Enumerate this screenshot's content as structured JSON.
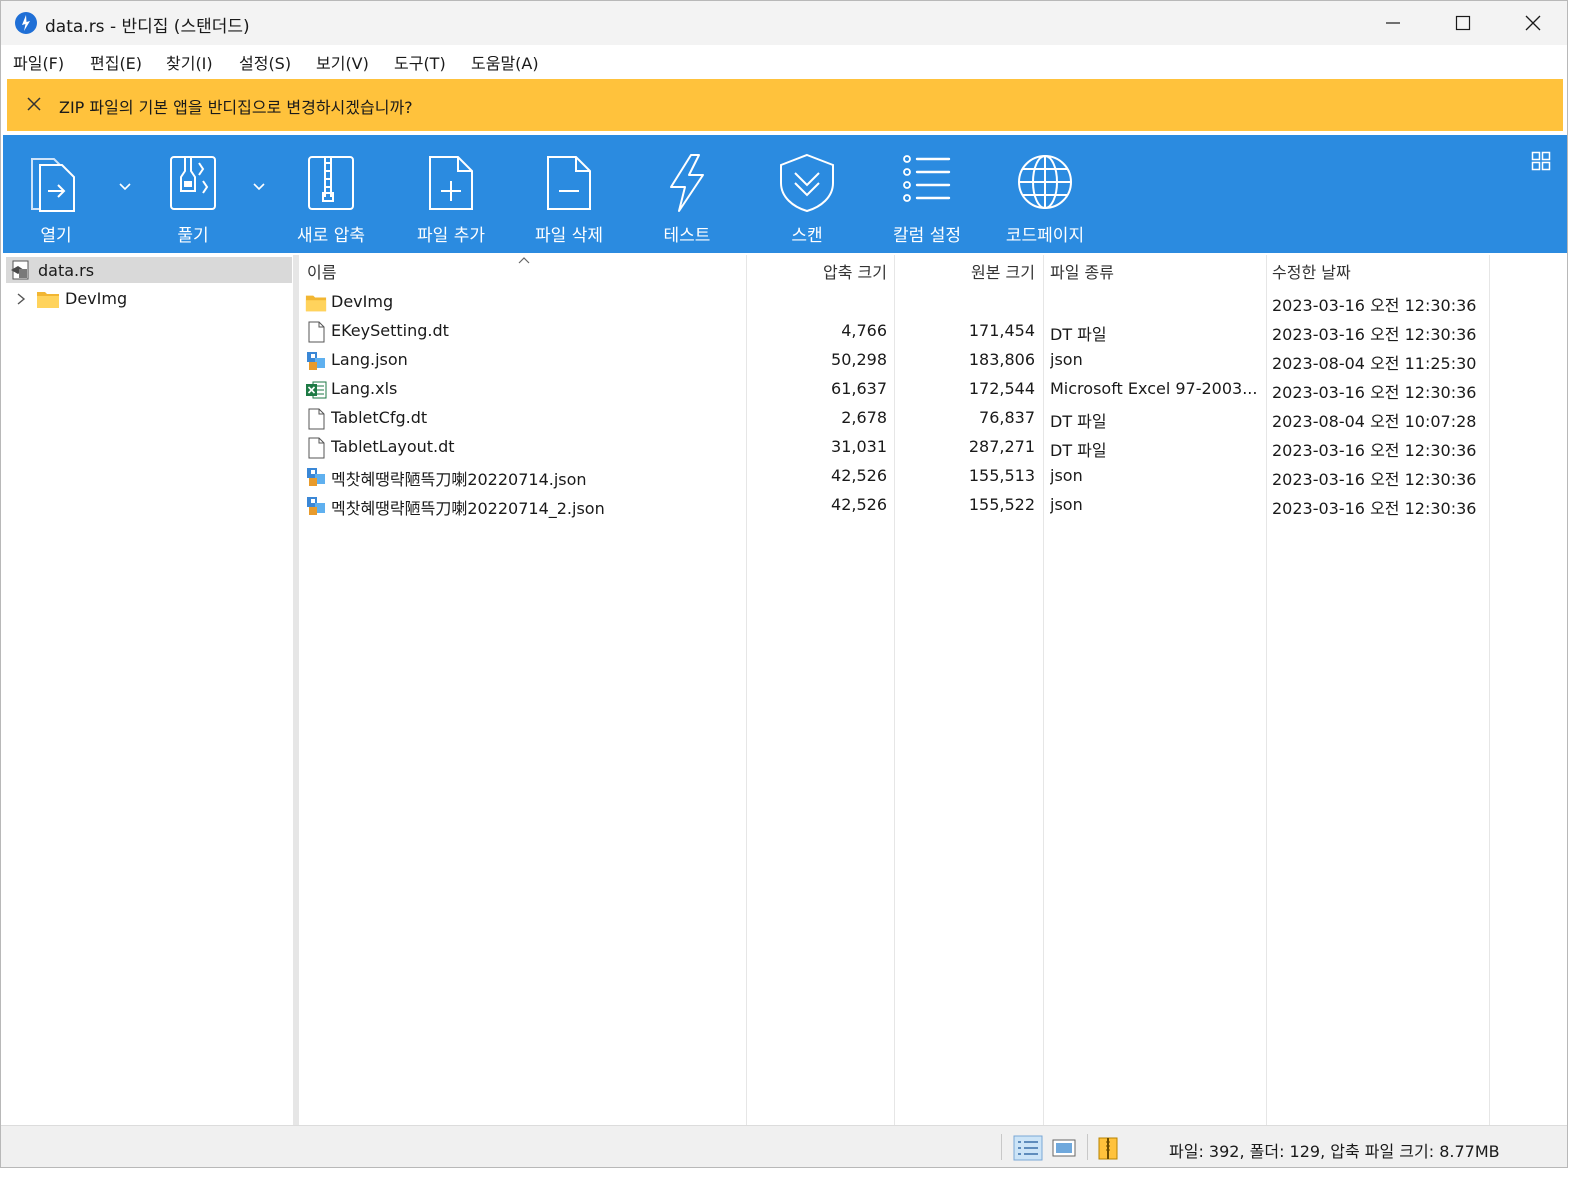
{
  "title": "data.rs - 반디집 (스탠더드)",
  "menu": [
    "파일(F)",
    "편집(E)",
    "찾기(I)",
    "설정(S)",
    "보기(V)",
    "도구(T)",
    "도움말(A)"
  ],
  "notification": {
    "text": "ZIP 파일의 기본 앱을 반디집으로 변경하시겠습니까?"
  },
  "toolbar": {
    "open": "열기",
    "extract": "풀기",
    "new_archive": "새로 압축",
    "add_files": "파일 추가",
    "delete_files": "파일 삭제",
    "test": "테스트",
    "scan": "스캔",
    "columns": "칼럼 설정",
    "codepage": "코드페이지"
  },
  "tree": {
    "root": "data.rs",
    "children": [
      "DevImg"
    ]
  },
  "columns": {
    "name": "이름",
    "compressed": "압축 크기",
    "original": "원본 크기",
    "type": "파일 종류",
    "modified": "수정한 날짜"
  },
  "files": [
    {
      "icon": "folder",
      "name": "DevImg",
      "compressed": "",
      "original": "",
      "type": "",
      "modified": "2023-03-16 오전 12:30:36"
    },
    {
      "icon": "file",
      "name": "EKeySetting.dt",
      "compressed": "4,766",
      "original": "171,454",
      "type": "DT 파일",
      "modified": "2023-03-16 오전 12:30:36"
    },
    {
      "icon": "json",
      "name": "Lang.json",
      "compressed": "50,298",
      "original": "183,806",
      "type": "json",
      "modified": "2023-08-04 오전 11:25:30"
    },
    {
      "icon": "excel",
      "name": "Lang.xls",
      "compressed": "61,637",
      "original": "172,544",
      "type": "Microsoft Excel 97-2003...",
      "modified": "2023-03-16 오전 12:30:36"
    },
    {
      "icon": "file",
      "name": "TabletCfg.dt",
      "compressed": "2,678",
      "original": "76,837",
      "type": "DT 파일",
      "modified": "2023-08-04 오전 10:07:28"
    },
    {
      "icon": "file",
      "name": "TabletLayout.dt",
      "compressed": "31,031",
      "original": "287,271",
      "type": "DT 파일",
      "modified": "2023-03-16 오전 12:30:36"
    },
    {
      "icon": "json",
      "name": "멕찻혜땡략陋뜩刀喇20220714.json",
      "compressed": "42,526",
      "original": "155,513",
      "type": "json",
      "modified": "2023-03-16 오전 12:30:36"
    },
    {
      "icon": "json",
      "name": "멕찻혜땡략陋뜩刀喇20220714_2.json",
      "compressed": "42,526",
      "original": "155,522",
      "type": "json",
      "modified": "2023-03-16 오전 12:30:36"
    }
  ],
  "status": {
    "text": "파일: 392, 폴더: 129, 압축 파일 크기: 8.77MB"
  },
  "colors": {
    "toolbar": "#2b8be0",
    "notification": "#ffc23c",
    "selection": "#d9d9d9"
  }
}
